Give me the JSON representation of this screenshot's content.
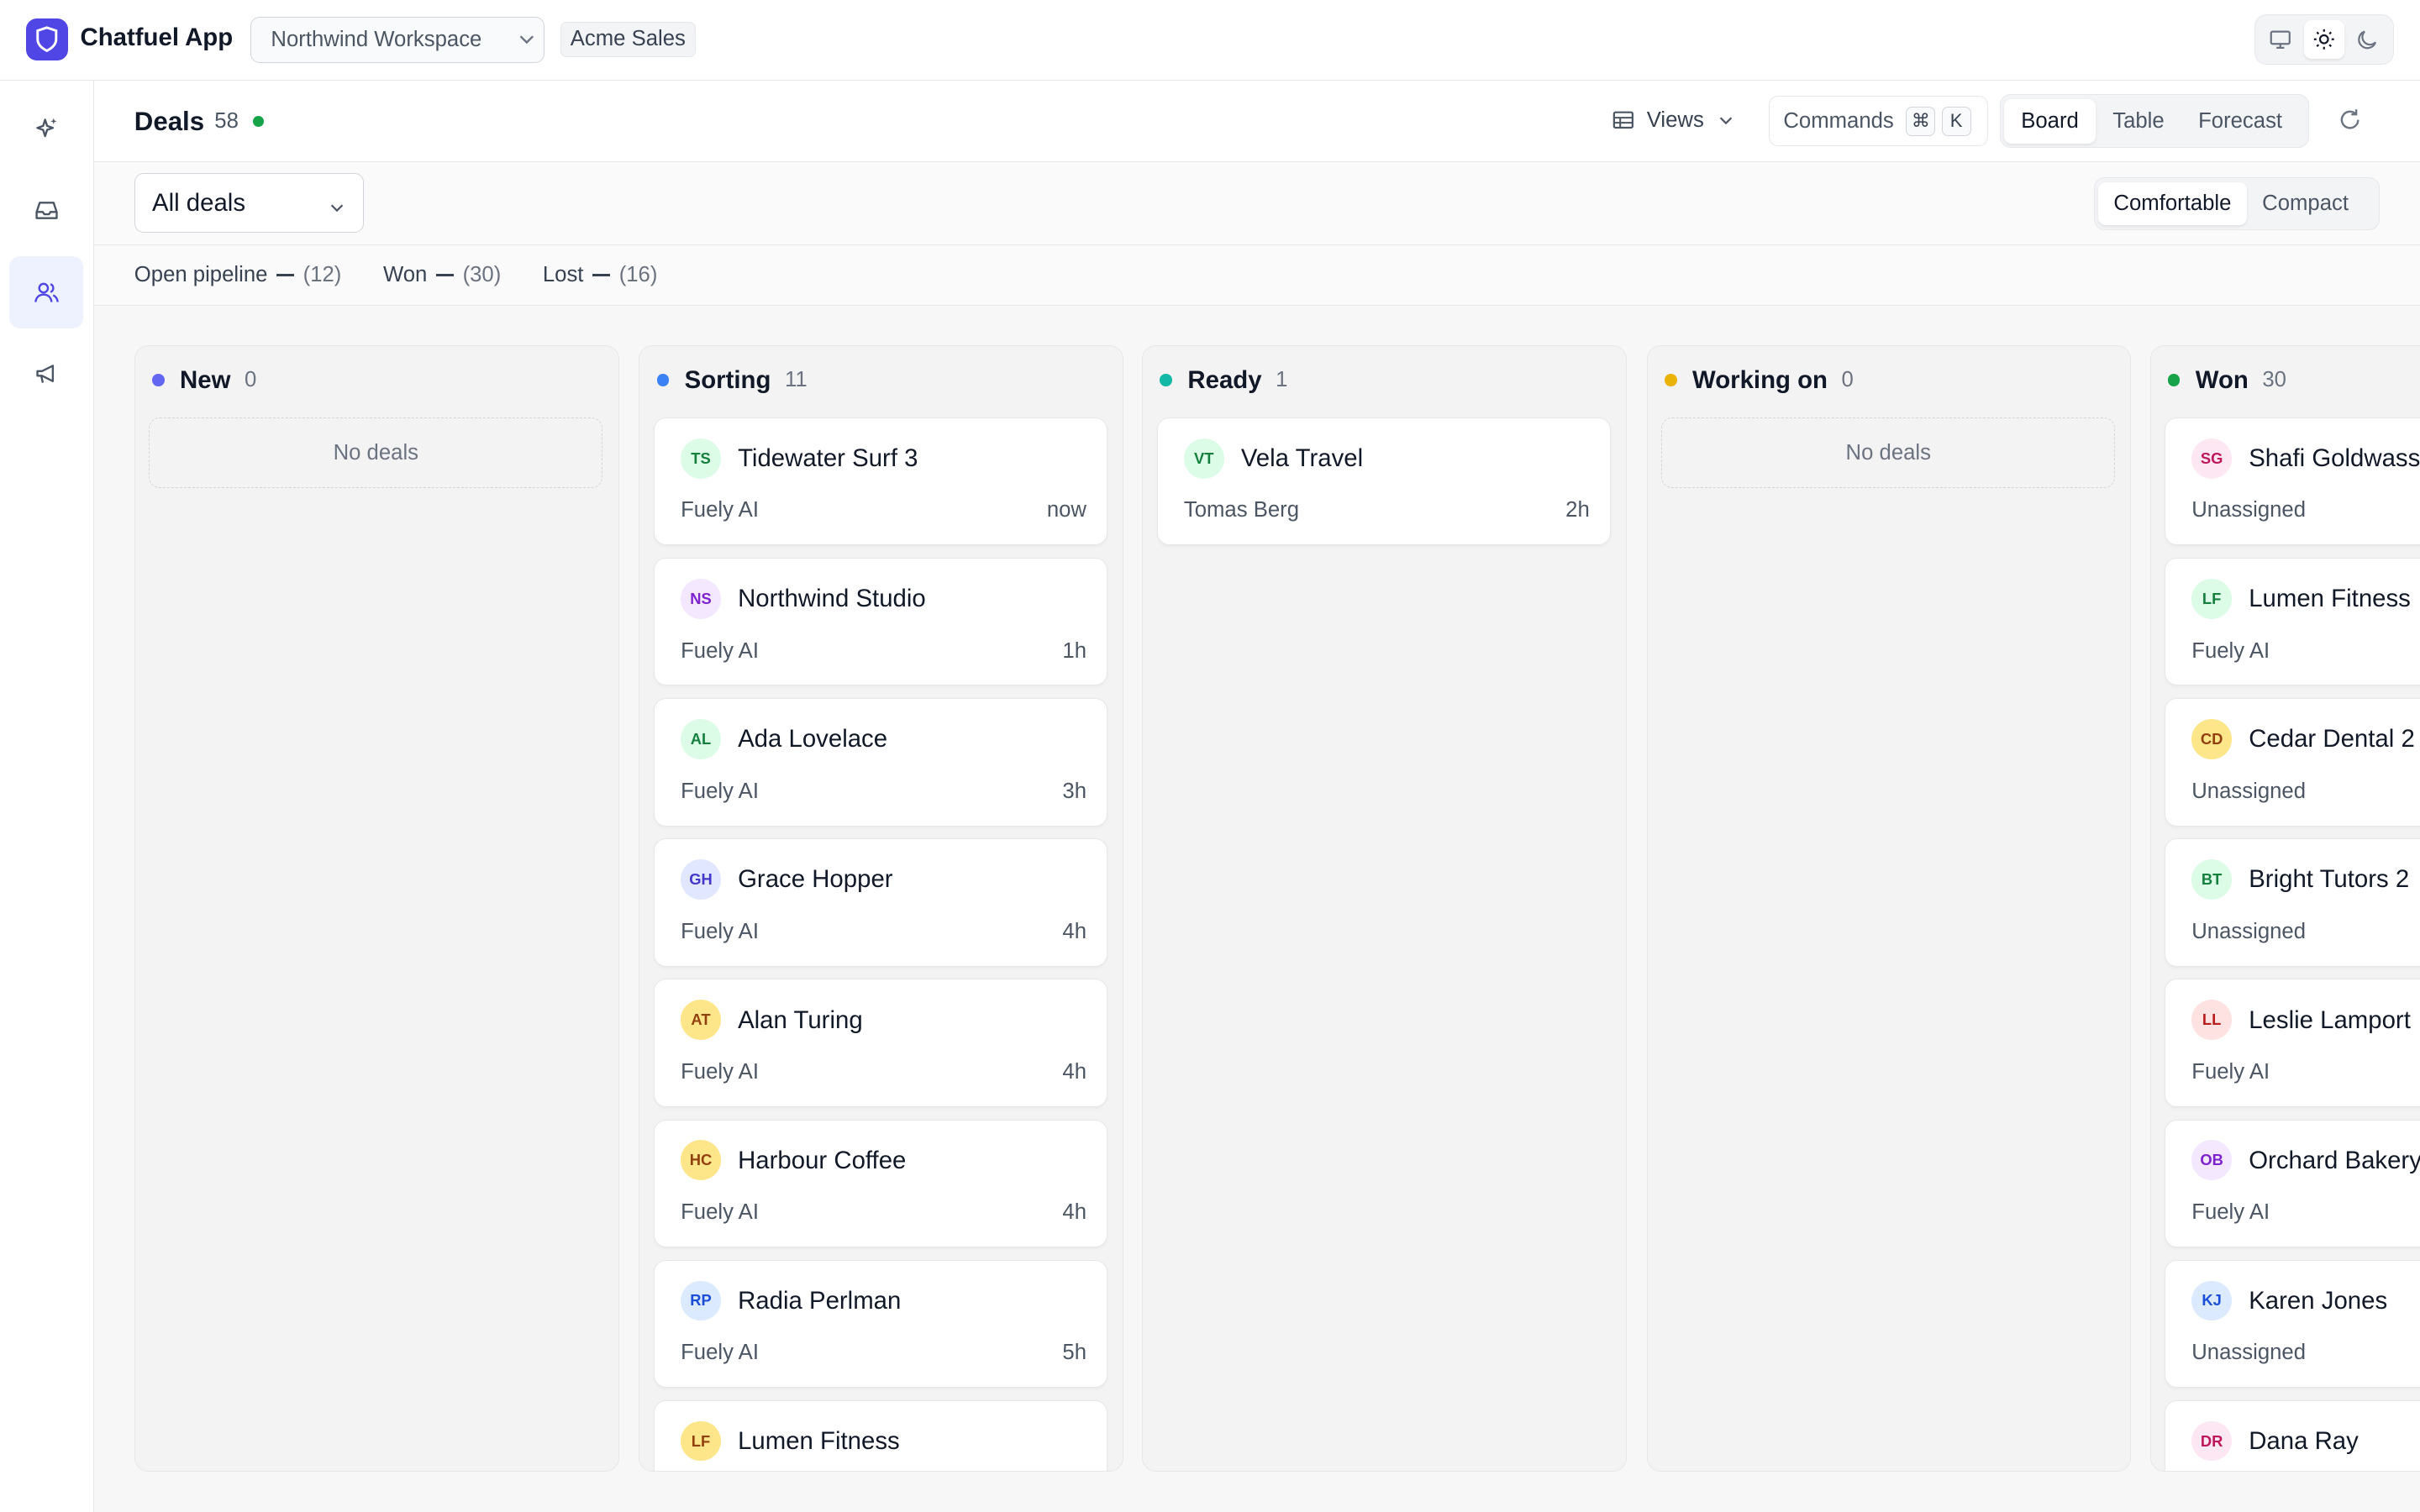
{
  "app": {
    "name": "Chatfuel App",
    "workspace": "Northwind Workspace",
    "org": "Acme Sales",
    "theme_icons": [
      "monitor-icon",
      "sun-icon",
      "moon-icon"
    ],
    "accent": "#4f46e5"
  },
  "sidebar": {
    "items": [
      {
        "icon": "sparkles-icon"
      },
      {
        "icon": "inbox-icon"
      },
      {
        "icon": "users-icon",
        "active": true
      },
      {
        "icon": "megaphone-icon"
      }
    ]
  },
  "header": {
    "title": "Deals",
    "count": "58",
    "views_label": "Views",
    "commands_label": "Commands",
    "kbd1": "⌘",
    "kbd2": "K",
    "tabs": [
      "Board",
      "Table",
      "Forecast"
    ],
    "active_tab": "Board"
  },
  "filter": {
    "deals_select": "All deals",
    "density": [
      "Comfortable",
      "Compact"
    ],
    "active_density": "Comfortable"
  },
  "stats": [
    {
      "label": "Open pipeline",
      "value": "(12)"
    },
    {
      "label": "Won",
      "value": "(30)"
    },
    {
      "label": "Lost",
      "value": "(16)"
    }
  ],
  "board": {
    "empty_text": "No deals",
    "columns": [
      {
        "title": "New",
        "count": "0",
        "color": "#6366f1",
        "cards": []
      },
      {
        "title": "Sorting",
        "count": "11",
        "color": "#3b82f6",
        "cards": [
          {
            "initials": "TS",
            "name": "Tidewater Surf 3",
            "owner": "Fuely AI",
            "time": "now",
            "bg": "#dcfce7",
            "fg": "#15803d"
          },
          {
            "initials": "NS",
            "name": "Northwind Studio",
            "owner": "Fuely AI",
            "time": "1h",
            "bg": "#f3e8ff",
            "fg": "#7e22ce"
          },
          {
            "initials": "AL",
            "name": "Ada Lovelace",
            "owner": "Fuely AI",
            "time": "3h",
            "bg": "#dcfce7",
            "fg": "#15803d"
          },
          {
            "initials": "GH",
            "name": "Grace Hopper",
            "owner": "Fuely AI",
            "time": "4h",
            "bg": "#e0e7ff",
            "fg": "#4338ca"
          },
          {
            "initials": "AT",
            "name": "Alan Turing",
            "owner": "Fuely AI",
            "time": "4h",
            "bg": "#fde68a",
            "fg": "#92400e"
          },
          {
            "initials": "HC",
            "name": "Harbour Coffee",
            "owner": "Fuely AI",
            "time": "4h",
            "bg": "#fde68a",
            "fg": "#92400e"
          },
          {
            "initials": "RP",
            "name": "Radia Perlman",
            "owner": "Fuely AI",
            "time": "5h",
            "bg": "#dbeafe",
            "fg": "#1d4ed8"
          },
          {
            "initials": "LF",
            "name": "Lumen Fitness",
            "owner": "",
            "time": "",
            "bg": "#fde68a",
            "fg": "#92400e"
          }
        ]
      },
      {
        "title": "Ready",
        "count": "1",
        "color": "#14b8a6",
        "cards": [
          {
            "initials": "VT",
            "name": "Vela Travel",
            "owner": "Tomas Berg",
            "time": "2h",
            "bg": "#dcfce7",
            "fg": "#15803d"
          }
        ]
      },
      {
        "title": "Working on",
        "count": "0",
        "color": "#eab308",
        "cards": []
      },
      {
        "title": "Won",
        "count": "30",
        "color": "#16a34a",
        "cards": [
          {
            "initials": "SG",
            "name": "Shafi Goldwasser",
            "owner": "Unassigned",
            "time": "",
            "bg": "#fce7f3",
            "fg": "#be185d"
          },
          {
            "initials": "LF",
            "name": "Lumen Fitness",
            "owner": "Fuely AI",
            "time": "",
            "bg": "#dcfce7",
            "fg": "#15803d"
          },
          {
            "initials": "CD",
            "name": "Cedar Dental 2",
            "owner": "Unassigned",
            "time": "",
            "bg": "#fde68a",
            "fg": "#92400e"
          },
          {
            "initials": "BT",
            "name": "Bright Tutors 2",
            "owner": "Unassigned",
            "time": "",
            "bg": "#dcfce7",
            "fg": "#15803d"
          },
          {
            "initials": "LL",
            "name": "Leslie Lamport",
            "owner": "Fuely AI",
            "time": "",
            "bg": "#fee2e2",
            "fg": "#b91c1c"
          },
          {
            "initials": "OB",
            "name": "Orchard Bakery",
            "owner": "Fuely AI",
            "time": "",
            "bg": "#f3e8ff",
            "fg": "#7e22ce"
          },
          {
            "initials": "KJ",
            "name": "Karen Jones",
            "owner": "Unassigned",
            "time": "",
            "bg": "#dbeafe",
            "fg": "#1d4ed8"
          },
          {
            "initials": "DR",
            "name": "Dana Ray",
            "owner": "",
            "time": "",
            "bg": "#fce7f3",
            "fg": "#be185d"
          }
        ]
      }
    ]
  }
}
